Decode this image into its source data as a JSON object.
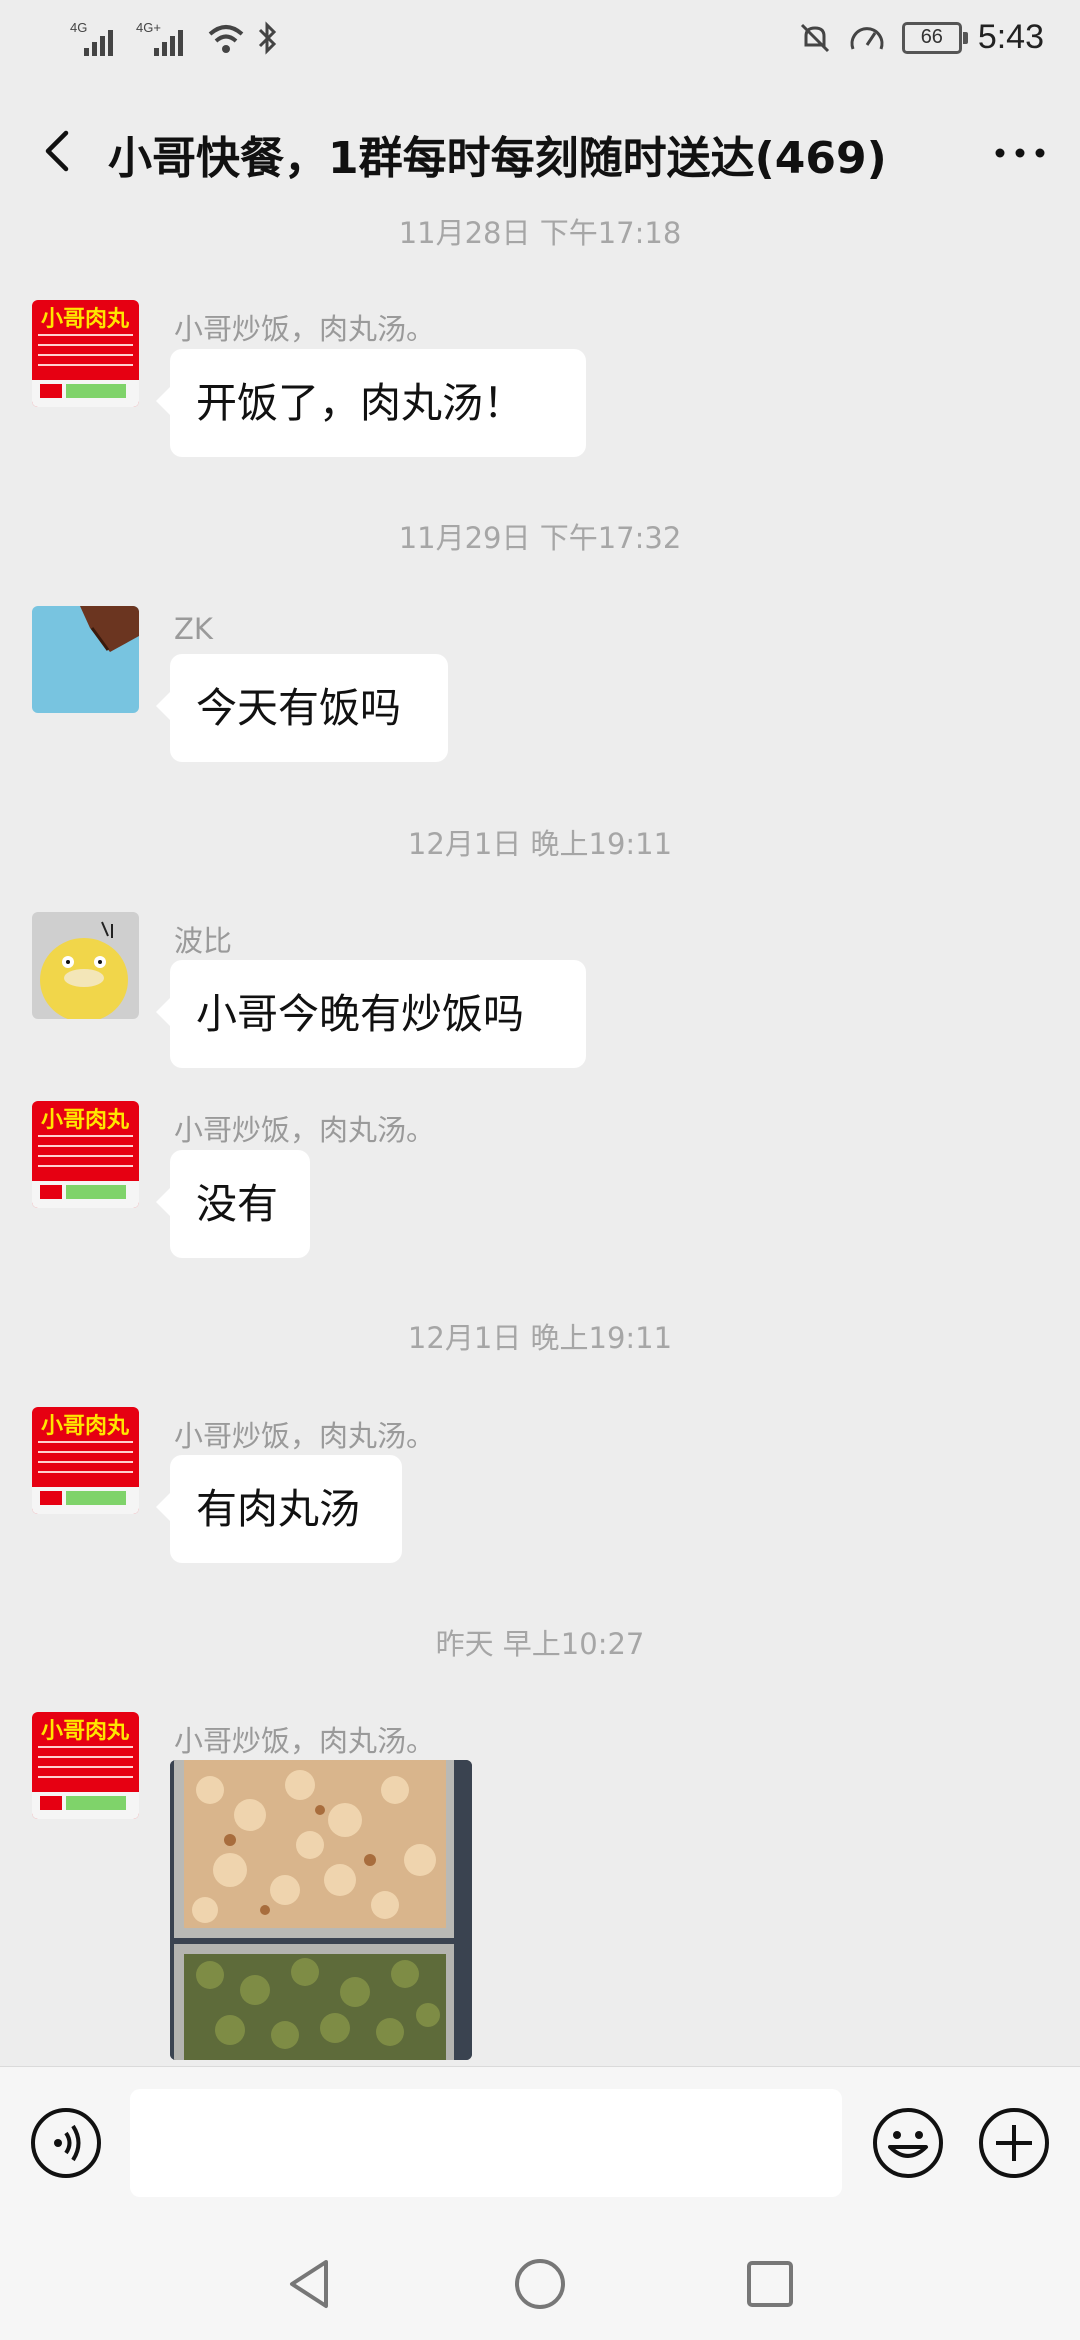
{
  "status_bar": {
    "network1": "4G",
    "network2": "4G+",
    "battery": "66",
    "time": "5:43"
  },
  "header": {
    "title": "小哥快餐，1群每时每刻随时送达(469)"
  },
  "avatar_sign": {
    "title": "小哥肉丸"
  },
  "messages": [
    {
      "timestamp": "11月28日 下午17:18"
    },
    {
      "sender": "小哥炒饭，肉丸汤。",
      "text": "开饭了，肉丸汤！"
    },
    {
      "timestamp": "11月29日 下午17:32"
    },
    {
      "sender": "ZK",
      "text": "今天有饭吗"
    },
    {
      "timestamp": "12月1日 晚上19:11"
    },
    {
      "sender": "波比",
      "text": "小哥今晚有炒饭吗"
    },
    {
      "sender": "小哥炒饭，肉丸汤。",
      "text": "没有"
    },
    {
      "timestamp": "12月1日 晚上19:11"
    },
    {
      "sender": "小哥炒饭，肉丸汤。",
      "text": "有肉丸汤"
    },
    {
      "timestamp": "昨天 早上10:27"
    },
    {
      "sender": "小哥炒饭，肉丸汤。",
      "image": "food-photo"
    }
  ],
  "input": {
    "value": "",
    "voice_icon": "voice-icon",
    "emoji_icon": "emoji-icon",
    "plus_icon": "plus-icon"
  },
  "nav": {
    "back_icon": "nav-back-icon",
    "home_icon": "nav-home-icon",
    "recent_icon": "nav-recent-icon"
  },
  "colors": {
    "background": "#ededed",
    "bubble": "#ffffff",
    "timestamp": "#a6a6a6",
    "sender": "#9a9a9a",
    "avatar_red": "#e60012"
  }
}
